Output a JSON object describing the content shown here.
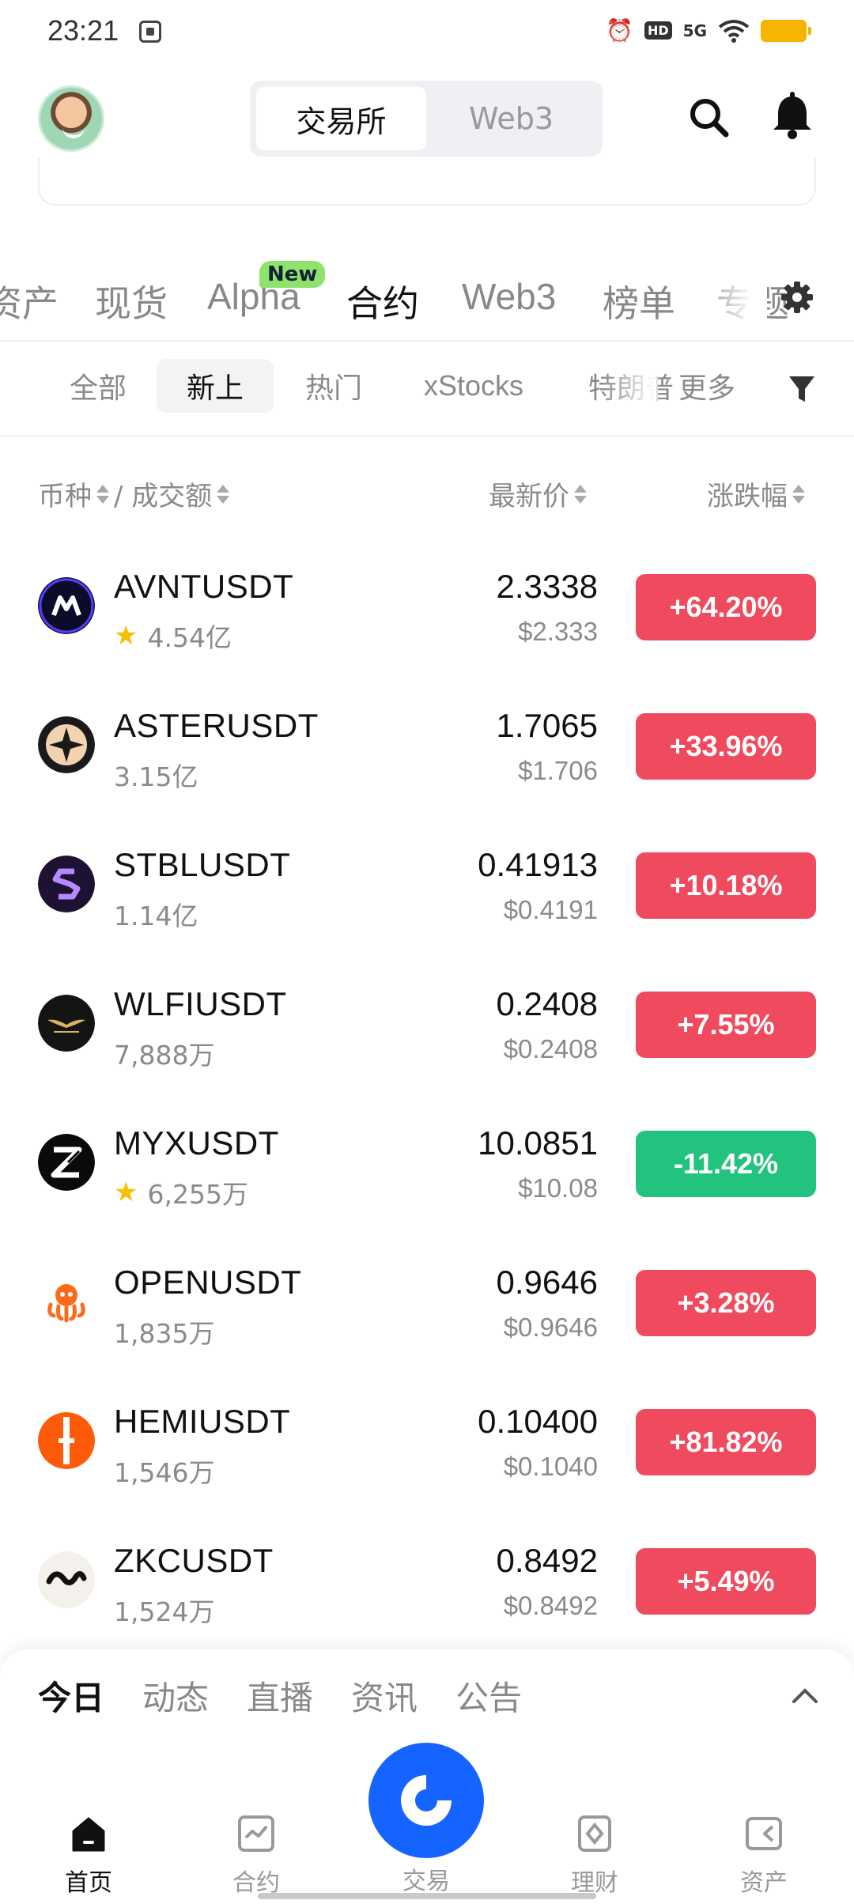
{
  "status_bar": {
    "time": "23:21",
    "network": "5G"
  },
  "header": {
    "segment": [
      {
        "label": "交易所",
        "active": true
      },
      {
        "label": "Web3",
        "active": false
      }
    ]
  },
  "category_tabs": [
    {
      "label": "资产",
      "active": false
    },
    {
      "label": "现货",
      "active": false
    },
    {
      "label": "Alpha",
      "active": false,
      "badge": "New"
    },
    {
      "label": "合约",
      "active": true
    },
    {
      "label": "Web3",
      "active": false
    },
    {
      "label": "榜单",
      "active": false
    },
    {
      "label": "专题",
      "active": false
    }
  ],
  "sub_tabs": [
    {
      "label": "全部",
      "active": false
    },
    {
      "label": "新上",
      "active": true
    },
    {
      "label": "热门",
      "active": false
    },
    {
      "label": "xStocks",
      "active": false
    },
    {
      "label": "特朗普",
      "active": false
    },
    {
      "label": "更多",
      "active": false
    }
  ],
  "columns": {
    "coin": "币种",
    "volume": "/ 成交额",
    "price": "最新价",
    "change": "涨跌幅"
  },
  "rows": [
    {
      "symbol": "AVNTUSDT",
      "volume": "4.54亿",
      "starred": true,
      "price": "2.3338",
      "usd": "$2.333",
      "change": "+64.20%",
      "direction": "up",
      "icon": "avnt-icon"
    },
    {
      "symbol": "ASTERUSDT",
      "volume": "3.15亿",
      "starred": false,
      "price": "1.7065",
      "usd": "$1.706",
      "change": "+33.96%",
      "direction": "up",
      "icon": "aster-icon"
    },
    {
      "symbol": "STBLUSDT",
      "volume": "1.14亿",
      "starred": false,
      "price": "0.41913",
      "usd": "$0.4191",
      "change": "+10.18%",
      "direction": "up",
      "icon": "stbl-icon"
    },
    {
      "symbol": "WLFIUSDT",
      "volume": "7,888万",
      "starred": false,
      "price": "0.2408",
      "usd": "$0.2408",
      "change": "+7.55%",
      "direction": "up",
      "icon": "wlfi-icon"
    },
    {
      "symbol": "MYXUSDT",
      "volume": "6,255万",
      "starred": true,
      "price": "10.0851",
      "usd": "$10.08",
      "change": "-11.42%",
      "direction": "down",
      "icon": "myx-icon"
    },
    {
      "symbol": "OPENUSDT",
      "volume": "1,835万",
      "starred": false,
      "price": "0.9646",
      "usd": "$0.9646",
      "change": "+3.28%",
      "direction": "up",
      "icon": "open-icon"
    },
    {
      "symbol": "HEMIUSDT",
      "volume": "1,546万",
      "starred": false,
      "price": "0.10400",
      "usd": "$0.1040",
      "change": "+81.82%",
      "direction": "up",
      "icon": "hemi-icon"
    },
    {
      "symbol": "ZKCUSDT",
      "volume": "1,524万",
      "starred": false,
      "price": "0.8492",
      "usd": "$0.8492",
      "change": "+5.49%",
      "direction": "up",
      "icon": "zkc-icon"
    }
  ],
  "news_tabs": [
    {
      "label": "今日",
      "active": true
    },
    {
      "label": "动态",
      "active": false
    },
    {
      "label": "直播",
      "active": false
    },
    {
      "label": "资讯",
      "active": false
    },
    {
      "label": "公告",
      "active": false
    }
  ],
  "bottom_nav": [
    {
      "label": "首页",
      "icon": "home-icon",
      "active": true
    },
    {
      "label": "合约",
      "icon": "futures-icon",
      "active": false
    },
    {
      "label": "交易",
      "icon": "trade-icon",
      "active": false
    },
    {
      "label": "理财",
      "icon": "earn-icon",
      "active": false
    },
    {
      "label": "资产",
      "icon": "assets-icon",
      "active": false
    }
  ],
  "colors": {
    "up": "#f04a5e",
    "down": "#22c27f",
    "accent": "#1664ff",
    "new_badge": "#8fe36d"
  }
}
